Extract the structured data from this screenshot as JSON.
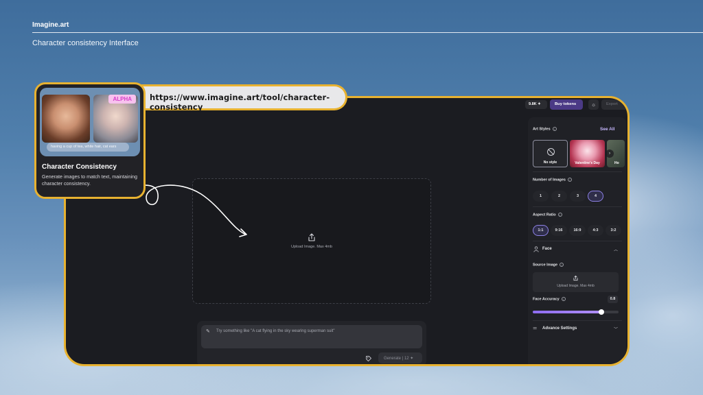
{
  "header": {
    "brand": "Imagine.art",
    "subtitle": "Character consistency Interface"
  },
  "browser": {
    "url": "https://www.imagine.art/tool/character-consistency"
  },
  "tool_card": {
    "badge": "ALPHA",
    "caption": "having a cup of tea, white hair, cat ears",
    "title": "Character Consistency",
    "description": "Generate images to match text, maintaining character consistency."
  },
  "topbar": {
    "tokens": "9.8K",
    "buy_tokens_label": "Buy tokens",
    "export_label": "Export"
  },
  "upload": {
    "text": "Upload Image. Max 4mb"
  },
  "prompt": {
    "placeholder": "Try something like \"A cat flying in the sky wearing superman suit\"",
    "generate_label": "Generate",
    "generate_cost": "12"
  },
  "panel": {
    "art_styles": {
      "label": "Art Styles",
      "see_all": "See All",
      "items": [
        {
          "name": "No style",
          "selected": true
        },
        {
          "name": "Valentine's Day",
          "selected": false
        },
        {
          "name": "Ho",
          "selected": false
        }
      ]
    },
    "number_of_images": {
      "label": "Number of Images",
      "options": [
        "1",
        "2",
        "3",
        "4"
      ],
      "selected": "4"
    },
    "aspect_ratio": {
      "label": "Aspect Ratio",
      "options": [
        "1:1",
        "9:16",
        "16:9",
        "4:3",
        "3:2"
      ],
      "selected": "1:1"
    },
    "face": {
      "label": "Face",
      "source_image_label": "Source Image",
      "upload_text": "Upload Image. Max 4mb",
      "accuracy_label": "Face Accuracy",
      "accuracy_value": "0.8",
      "accuracy_fraction": 0.8
    },
    "advance_settings_label": "Advance Settings"
  },
  "colors": {
    "highlight_border": "#e8b230",
    "accent": "#8e82e6",
    "buy_button": "#4b3a86"
  }
}
